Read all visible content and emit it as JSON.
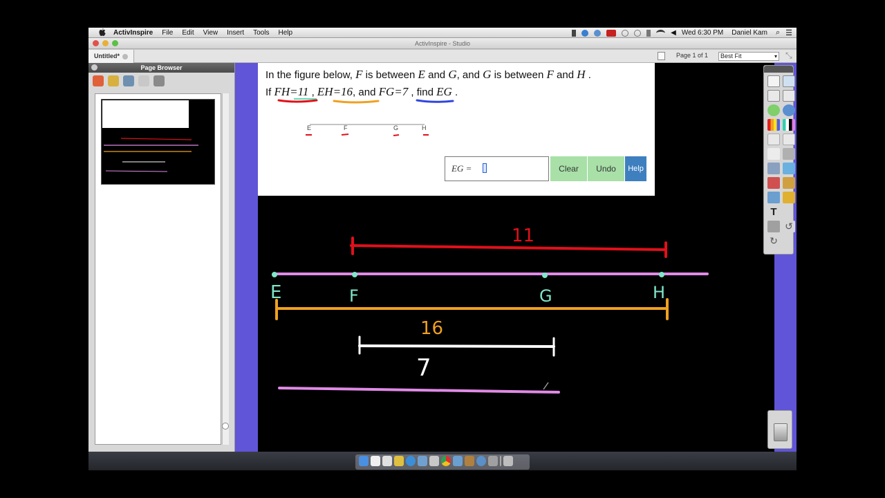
{
  "menubar": {
    "app_name": "ActivInspire",
    "items": [
      "File",
      "Edit",
      "View",
      "Insert",
      "Tools",
      "Help"
    ],
    "clock": "Wed 6:30 PM",
    "user": "Daniel Kam"
  },
  "window": {
    "title": "ActivInspire - Studio",
    "tab_label": "Untitled*",
    "page_info": "Page 1 of 1",
    "fit_option": "Best Fit"
  },
  "page_browser": {
    "title": "Page Browser"
  },
  "question": {
    "line1_prefix": "In the figure below,",
    "var_F": "F",
    "between1": "is between",
    "var_E": "E",
    "and1": "and",
    "var_G": "G",
    "comma_and": ", and",
    "var_G2": "G",
    "between2": "is between",
    "var_F2": "F",
    "and2": "and",
    "var_H": "H",
    "period": ".",
    "line2_if": "If",
    "expr_FH": "FH=11",
    "sep1": ",",
    "expr_EH": "EH=16",
    "sep2": ", and",
    "expr_FG": "FG=7",
    "find": ", find",
    "expr_EG": "EG",
    "period2": "."
  },
  "figure": {
    "points": [
      "E",
      "F",
      "G",
      "H"
    ]
  },
  "answer": {
    "label": "EG =",
    "value": ""
  },
  "buttons": {
    "clear": "Clear",
    "undo": "Undo",
    "help": "Help"
  },
  "drawing": {
    "label_FH": "11",
    "label_EH": "16",
    "label_FG": "7",
    "point_labels": [
      "E",
      "F",
      "G",
      "H"
    ],
    "colors": {
      "FH": "#e0101a",
      "EH": "#f0a020",
      "FG": "#ffffff",
      "line": "#e08ae6",
      "points": "#7fe6c8"
    }
  },
  "colors": {
    "accent_purple": "#6055d8",
    "button_green": "#a8e0a8",
    "button_blue": "#3e7fbf"
  }
}
